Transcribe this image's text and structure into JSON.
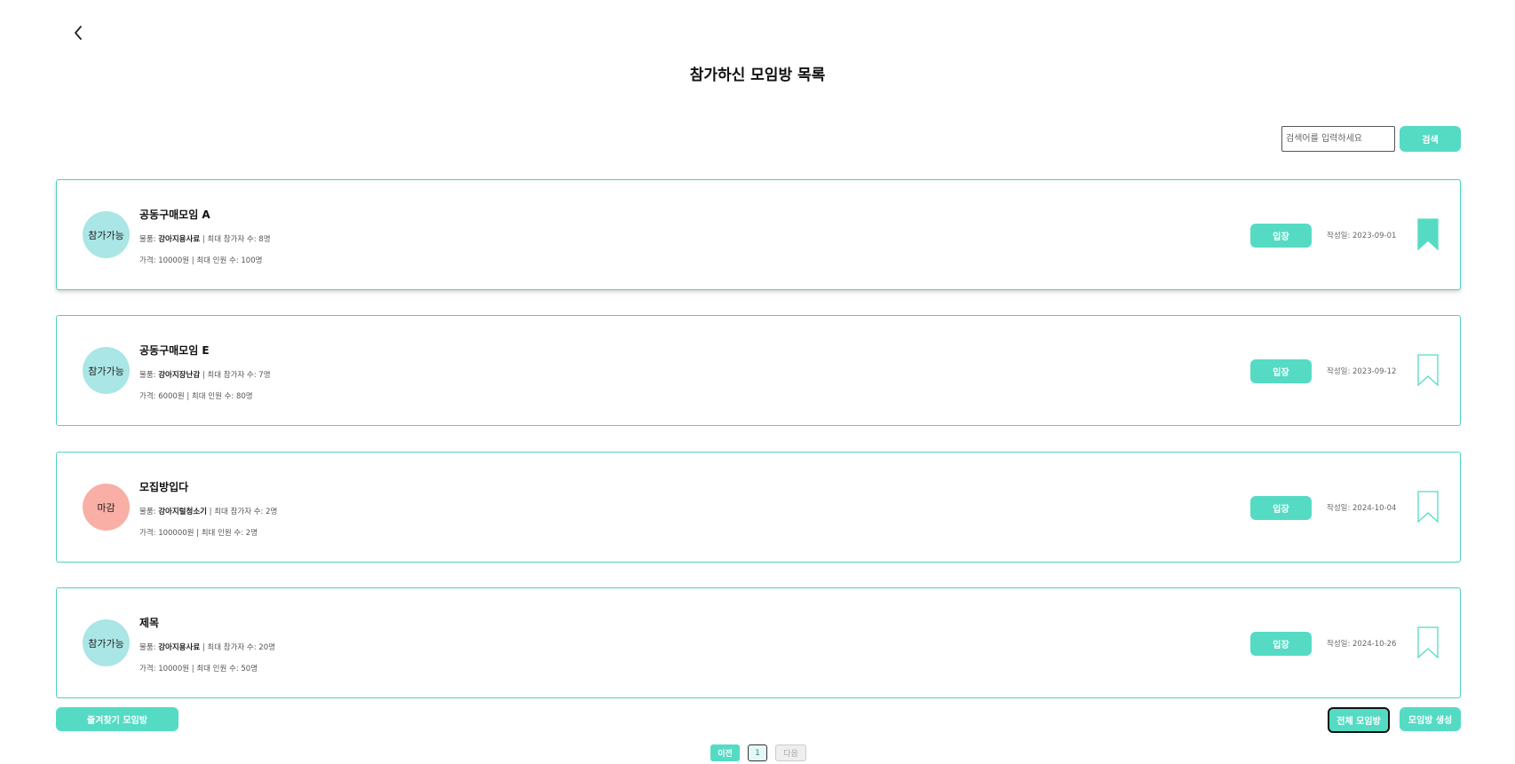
{
  "colors": {
    "accent": "#55dbc4",
    "card_border": "#4fd1c0",
    "status_open": "#a9e6e5",
    "status_closed": "#f9aea6"
  },
  "header": {
    "back_icon": "chevron-left-icon",
    "title": "참가하신 모임방 목록"
  },
  "search": {
    "placeholder": "검색어를 입력하세요",
    "button_label": "검색"
  },
  "rooms": [
    {
      "status": "참가가능",
      "status_type": "open",
      "title": "공동구매모임 A",
      "item_label": "물품: ",
      "item": "강아지용사료",
      "max_participants": " | 최대 참가자 수: 8명",
      "price_info": "가격: 10000원 | 최대 인원 수: 100명",
      "enter_label": "입장",
      "created": "작성일: 2023-09-01",
      "bookmarked": true
    },
    {
      "status": "참가가능",
      "status_type": "open",
      "title": "공동구매모임 E",
      "item_label": "물품: ",
      "item": "강아지장난감",
      "max_participants": " | 최대 참가자 수: 7명",
      "price_info": "가격: 6000원 | 최대 인원 수: 80명",
      "enter_label": "입장",
      "created": "작성일: 2023-09-12",
      "bookmarked": false
    },
    {
      "status": "마감",
      "status_type": "closed",
      "title": "모집방입다",
      "item_label": "물품: ",
      "item": "강아지털청소기",
      "max_participants": " | 최대 참가자 수: 2명",
      "price_info": "가격: 100000원 | 최대 인원 수: 2명",
      "enter_label": "입장",
      "created": "작성일: 2024-10-04",
      "bookmarked": false
    },
    {
      "status": "참가가능",
      "status_type": "open",
      "title": "제목",
      "item_label": "물품: ",
      "item": "강아지용사료",
      "max_participants": " | 최대 참가자 수: 20명",
      "price_info": "가격: 10000원 | 최대 인원 수: 50명",
      "enter_label": "입장",
      "created": "작성일: 2024-10-26",
      "bookmarked": false
    }
  ],
  "footer": {
    "favorites_label": "즐겨찾기 모임방",
    "all_rooms_label": "전체 모임방",
    "create_room_label": "모임방 생성"
  },
  "pagination": {
    "prev_label": "이전",
    "current_page": "1",
    "next_label": "다음"
  }
}
